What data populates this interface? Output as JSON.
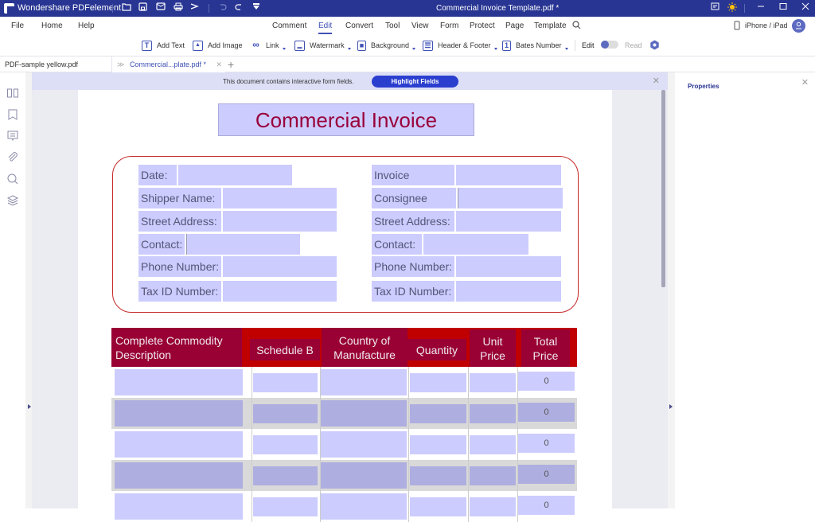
{
  "app": {
    "name": "Wondershare PDFelement",
    "document_title": "Commercial Invoice Template.pdf *"
  },
  "titlebar_icons": [
    "folder-open-icon",
    "save-icon",
    "mail-icon",
    "print-icon",
    "share-icon",
    "undo-icon",
    "redo-icon",
    "customize-icon",
    "feedback-icon",
    "theme-sun-icon",
    "minimize-icon",
    "maximize-icon",
    "close-icon"
  ],
  "menu": {
    "left": [
      "File",
      "Home",
      "Help"
    ],
    "center": [
      "Comment",
      "Edit",
      "Convert",
      "Tool",
      "View",
      "Form",
      "Protect",
      "Page",
      "Template"
    ],
    "active": "Edit",
    "device_label": "iPhone / iPad"
  },
  "toolbar": {
    "items": [
      {
        "label": "Add Text",
        "icon": "T"
      },
      {
        "label": "Add Image",
        "icon": "▲"
      },
      {
        "label": "Link",
        "icon": "∞"
      },
      {
        "label": "Watermark",
        "icon": "▬"
      },
      {
        "label": "Background",
        "icon": "■"
      },
      {
        "label": "Header & Footer",
        "icon": "☰"
      },
      {
        "label": "Bates Number",
        "icon": "1"
      }
    ],
    "mode_edit": "Edit",
    "mode_read": "Read"
  },
  "tabs": [
    {
      "label": "PDF-sample yellow.pdf",
      "active": false
    },
    {
      "label": "Commercial...plate.pdf *",
      "active": true
    }
  ],
  "notice": {
    "text": "This document contains interactive form fields.",
    "button": "Highlight Fields"
  },
  "properties": {
    "title": "Properties"
  },
  "form": {
    "title": "Commercial Invoice",
    "left_fields": [
      "Date:",
      "Shipper Name:",
      "Street Address:",
      "Contact:",
      "Phone Number:",
      "Tax ID Number:"
    ],
    "right_fields": [
      "Invoice Number:",
      "Consignee Name:",
      "Street Address:",
      "Contact:",
      "Phone Number:",
      "Tax ID Number:"
    ],
    "table_headers": [
      "Complete Commodity Description",
      "Schedule B",
      "Country of Manufacture",
      "Quantity",
      "Unit Price",
      "Total Price"
    ],
    "rows": [
      {
        "total": "0"
      },
      {
        "total": "0"
      },
      {
        "total": "0"
      },
      {
        "total": "0"
      },
      {
        "total": "0"
      }
    ]
  },
  "colors": {
    "accent": "#3f51b5",
    "titlebar": "#283593",
    "field_fill": "#ccccff",
    "header_maroon": "#990033",
    "header_red": "#c00000"
  }
}
